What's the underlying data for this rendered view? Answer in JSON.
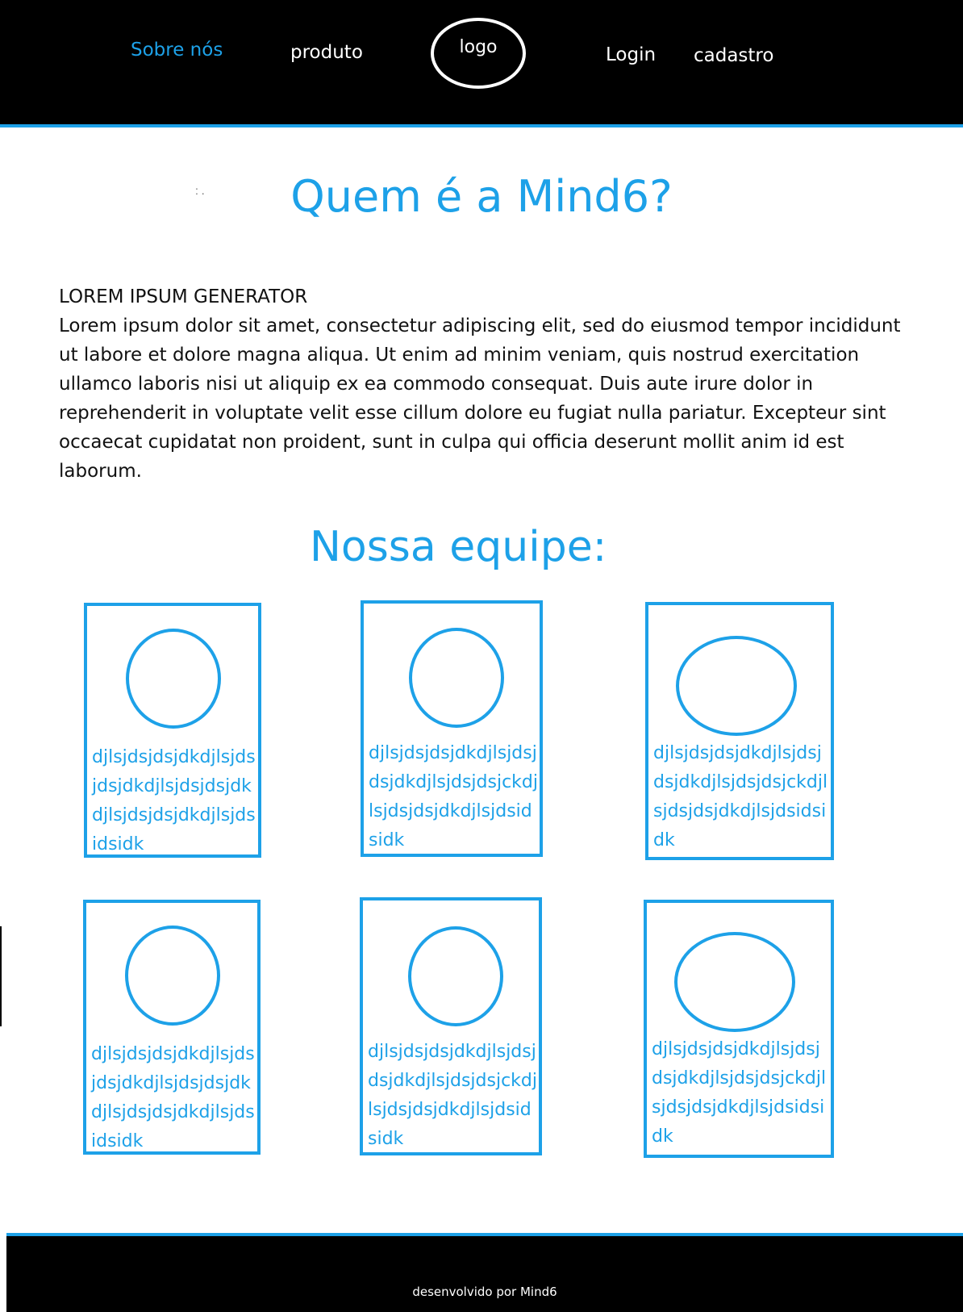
{
  "colors": {
    "accent": "#1da1e8",
    "header_bg": "#000000",
    "nav_text": "#ffffff"
  },
  "header": {
    "nav": {
      "sobre_nos": "Sobre nós",
      "produto": "produto",
      "logo": "logo",
      "login": "Login",
      "cadastro": "cadastro"
    }
  },
  "main": {
    "title": "Quem é a Mind6?",
    "intro_heading": "LOREM IPSUM GENERATOR",
    "intro_body": "Lorem ipsum dolor sit amet, consectetur adipiscing elit, sed do eiusmod tempor incididunt ut labore et dolore magna aliqua. Ut enim ad minim veniam, quis nostrud exercitation ullamco laboris nisi ut aliquip ex ea commodo consequat. Duis aute irure dolor in reprehenderit in voluptate velit esse cillum dolore eu fugiat nulla pariatur. Excepteur sint occaecat cupidatat non proident, sunt in culpa qui officia deserunt mollit anim id est laborum.",
    "team_title": "Nossa equipe:",
    "team": [
      {
        "text": "djlsjdsjdsjdkdjlsjdsjdsjdkdjlsjdsjdsjdkdjlsjdsjdsjdkdjlsjdsidsidk"
      },
      {
        "text": "djlsjdsjdsjdkdjlsjdsjdsjdkdjlsjdsjdsjckdjlsjdsjdsjdkdjlsjdsidsidk"
      },
      {
        "text": "djlsjdsjdsjdkdjlsjdsjdsjdkdjlsjdsjdsjckdjlsjdsjdsjdkdjlsjdsidsidk"
      },
      {
        "text": "djlsjdsjdsjdkdjlsjdsjdsjdkdjlsjdsjdsjdkdjlsjdsjdsjdkdjlsjdsidsidk"
      },
      {
        "text": "djlsjdsjdsjdkdjlsjdsjdsjdkdjlsjdsjdsjckdjlsjdsjdsjdkdjlsjdsidsidk"
      },
      {
        "text": "djlsjdsjdsjdkdjlsjdsjdsjdkdjlsjdsjdsjckdjlsjdsjdsjdkdjlsjdsidsidk"
      }
    ]
  },
  "footer": {
    "text": "desenvolvido por Mind6"
  }
}
